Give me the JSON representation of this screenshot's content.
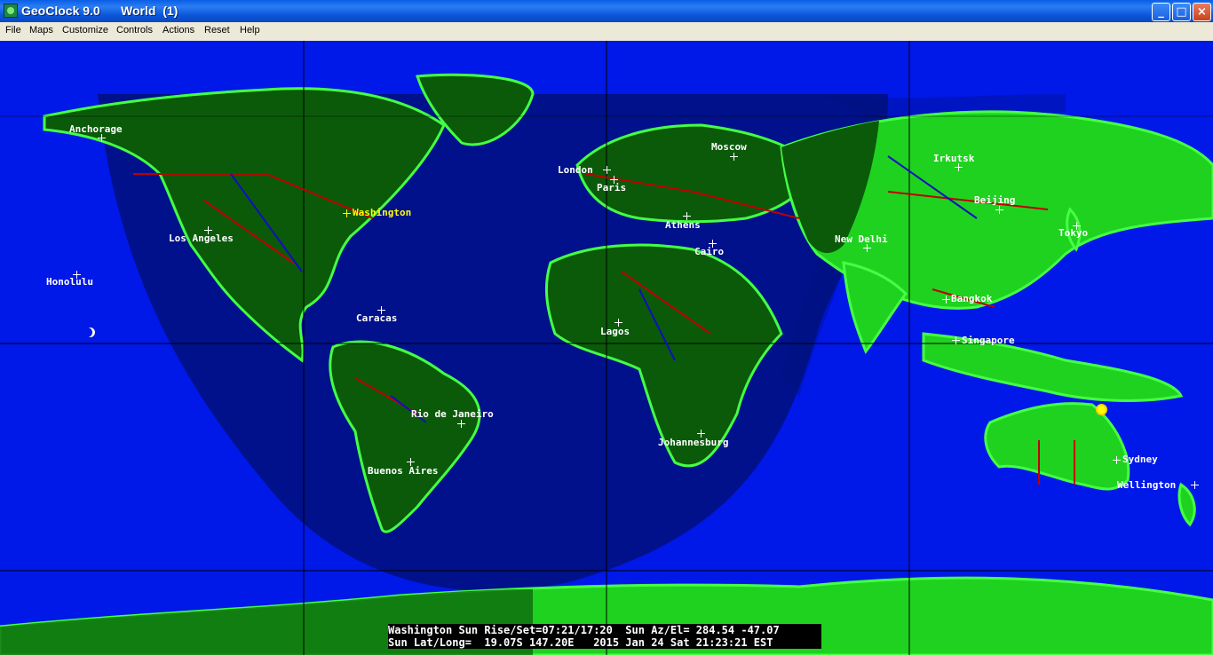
{
  "window": {
    "title": "GeoClock 9.0      World  (1)",
    "buttons": {
      "minimize": "_",
      "maximize": "□",
      "close": "×"
    }
  },
  "menu": [
    "File",
    "Maps",
    "Customize",
    "Controls",
    "Actions",
    "Reset",
    "Help"
  ],
  "cities": [
    {
      "name": "Anchorage"
    },
    {
      "name": "Washington",
      "highlight": true
    },
    {
      "name": "Los Angeles"
    },
    {
      "name": "Honolulu"
    },
    {
      "name": "Caracas"
    },
    {
      "name": "Rio de Janeiro"
    },
    {
      "name": "Buenos Aires"
    },
    {
      "name": "London"
    },
    {
      "name": "Paris"
    },
    {
      "name": "Moscow"
    },
    {
      "name": "Athens"
    },
    {
      "name": "Cairo"
    },
    {
      "name": "Lagos"
    },
    {
      "name": "Johannesburg"
    },
    {
      "name": "New Delhi"
    },
    {
      "name": "Irkutsk"
    },
    {
      "name": "Beijing"
    },
    {
      "name": "Tokyo"
    },
    {
      "name": "Bangkok"
    },
    {
      "name": "Singapore"
    },
    {
      "name": "Sydney"
    },
    {
      "name": "Wellington"
    }
  ],
  "status": {
    "line1": "Washington Sun Rise/Set=07:21/17:20  Sun Az/El= 284.54 -47.07",
    "line2": "Sun Lat/Long=  19.07S 147.20E   2015 Jan 24 Sat 21:23:21 EST"
  },
  "colors": {
    "ocean_day": "#0018e8",
    "ocean_night": "#00107a",
    "land_day": "#1fd21f",
    "land_night": "#0a5a0a",
    "coast": "#44ff44",
    "borders": "#c00000",
    "rivers": "#1010c0"
  },
  "icons": {
    "moon": "moon-icon",
    "sun": "sun-icon"
  }
}
